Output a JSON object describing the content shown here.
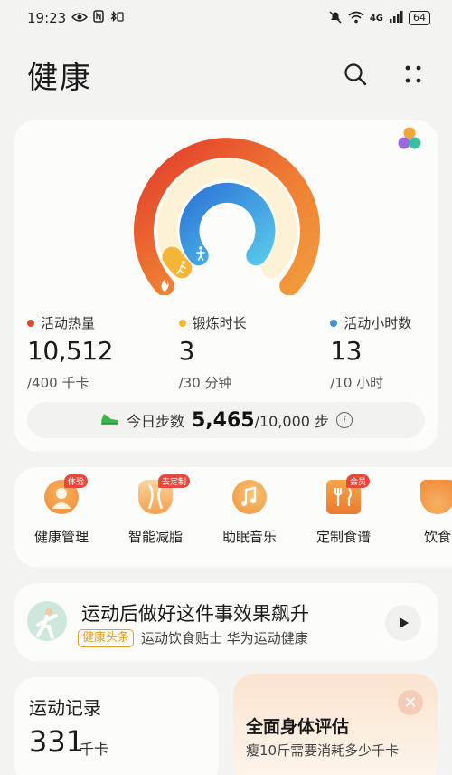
{
  "status": {
    "time": "19:23",
    "battery": "64",
    "network": "4G"
  },
  "header": {
    "title": "健康"
  },
  "rings": {
    "colors": {
      "activity": "#e9573a",
      "exercise": "#f5b637",
      "stand": "#3f8fdb"
    },
    "progress": {
      "activity": 1.0,
      "exercise": 0.1,
      "stand": 1.0
    }
  },
  "stats": [
    {
      "label": "活动热量",
      "value": "10,512",
      "goal": "/400 千卡",
      "color": "#e2482f"
    },
    {
      "label": "锻炼时长",
      "value": "3",
      "goal": "/30 分钟",
      "color": "#f5b637"
    },
    {
      "label": "活动小时数",
      "value": "13",
      "goal": "/10 小时",
      "color": "#3f8fdb"
    }
  ],
  "steps": {
    "prefix": "今日步数",
    "value": "5,465",
    "goal": "/10,000 步"
  },
  "services": [
    {
      "label": "健康管理",
      "badge": "体验",
      "icon": "health-management-icon"
    },
    {
      "label": "智能减脂",
      "badge": "去定制",
      "icon": "fat-loss-icon"
    },
    {
      "label": "助眠音乐",
      "badge": "",
      "icon": "sleep-music-icon"
    },
    {
      "label": "定制食谱",
      "badge": "会员",
      "icon": "recipe-icon"
    },
    {
      "label": "饮食",
      "badge": "",
      "icon": "diet-icon"
    }
  ],
  "article": {
    "title": "运动后做好这件事效果飙升",
    "tag": "健康头条",
    "source": "运动饮食贴士 华为运动健康"
  },
  "record": {
    "title": "运动记录",
    "value": "331",
    "unit": "千卡"
  },
  "assessment": {
    "title": "全面身体评估",
    "subtitle": "瘦10斤需要消耗多少千卡"
  }
}
